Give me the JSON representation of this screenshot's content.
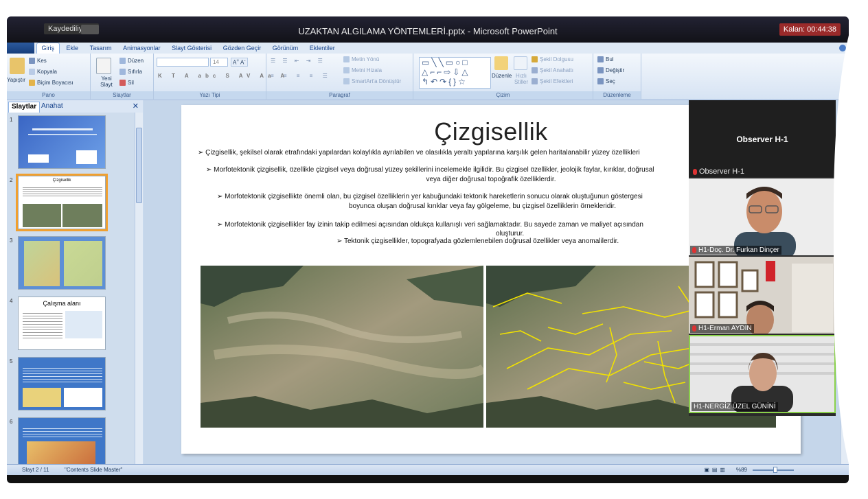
{
  "titlebar": {
    "saving_text": "Kaydediliyor...",
    "doc_title": "UZAKTAN ALGILAMA YÖNTEMLERİ.pptx - Microsoft PowerPoint",
    "timer_label": "Kalan: 00:44:38"
  },
  "tabs": [
    "Giriş",
    "Ekle",
    "Tasarım",
    "Animasyonlar",
    "Slayt Gösterisi",
    "Gözden Geçir",
    "Görünüm",
    "Eklentiler"
  ],
  "ribbon": {
    "pano": {
      "label": "Pano",
      "paste": "Yapıştır",
      "cut": "Kes",
      "copy": "Kopyala",
      "format_painter": "Biçim Boyacısı"
    },
    "slaytlar": {
      "label": "Slaytlar",
      "new_slide": "Yeni Slayt",
      "layout": "Düzen",
      "reset": "Sıfırla",
      "delete": "Sil"
    },
    "yazi_tipi": {
      "label": "Yazı Tipi",
      "font_size": "14"
    },
    "paragraf": {
      "label": "Paragraf",
      "text_direction": "Metin Yönü",
      "align_text": "Metni Hizala",
      "smartart": "SmartArt'a Dönüştür"
    },
    "cizim": {
      "label": "Çizim",
      "arrange": "Düzenle",
      "quick_styles": "Hızlı Stiller",
      "shape_fill": "Şekil Dolgusu",
      "shape_outline": "Şekil Anahattı",
      "shape_effects": "Şekil Efektleri"
    },
    "duzenleme": {
      "label": "Düzenleme",
      "find": "Bul",
      "replace": "Değiştir",
      "select": "Seç"
    }
  },
  "left_panel": {
    "tab_slides": "Slaytlar",
    "tab_outline": "Anahat",
    "thumbs": [
      {
        "num": "1"
      },
      {
        "num": "2",
        "title": "Çizgisellik"
      },
      {
        "num": "3"
      },
      {
        "num": "4",
        "title": "Çalışma alanı"
      },
      {
        "num": "5"
      },
      {
        "num": "6"
      }
    ]
  },
  "slide": {
    "title": "Çizgisellik",
    "bullets": [
      "➢ Çizgisellik, şekilsel olarak etrafındaki yapılardan kolaylıkla ayrılabilen ve olasılıkla yeraltı yapılarına karşılık gelen haritalanabilir yüzey özellikleri",
      "➢ Morfotektonik çizgisellik, özellikle çizgisel veya doğrusal yüzey şekillerini incelemekle ilgilidir. Bu çizgisel özellikler, jeolojik faylar, kırıklar, doğrusal",
      "veya diğer doğrusal topoğrafik özelliklerdir.",
      "➢ Morfotektonik çizgisellikte önemli olan, bu çizgisel özelliklerin yer kabuğundaki tektonik hareketlerin sonucu olarak oluştuğunun göstergesi",
      "boyunca oluşan doğrusal kırıklar veya fay gölgeleme, bu çizgisel özelliklerin örnekleridir.",
      "➢ Morfotektonik çizgisellikler fay izinin takip edilmesi açısından oldukça kullanışlı veri sağlamaktadır. Bu sayede zaman ve maliyet açısından",
      "oluşturur.",
      "➢ Tektonik çizgisellikler, topografyada gözlemlenebilen doğrusal özellikler veya anomalilerdir."
    ]
  },
  "statusbar": {
    "slide_info": "Slayt 2 / 11",
    "theme": "\"Contents Slide Master\"",
    "zoom": "%89"
  },
  "video": {
    "header_name": "Observer H-1",
    "header_sub": "Observer H-1",
    "tiles": [
      {
        "label": "H1-Doç. Dr. Furkan Dinçer"
      },
      {
        "label": "H1-Erman AYDIN"
      },
      {
        "label": "H1-NERGİZ ÜZEL GÜNİNİ"
      }
    ]
  }
}
